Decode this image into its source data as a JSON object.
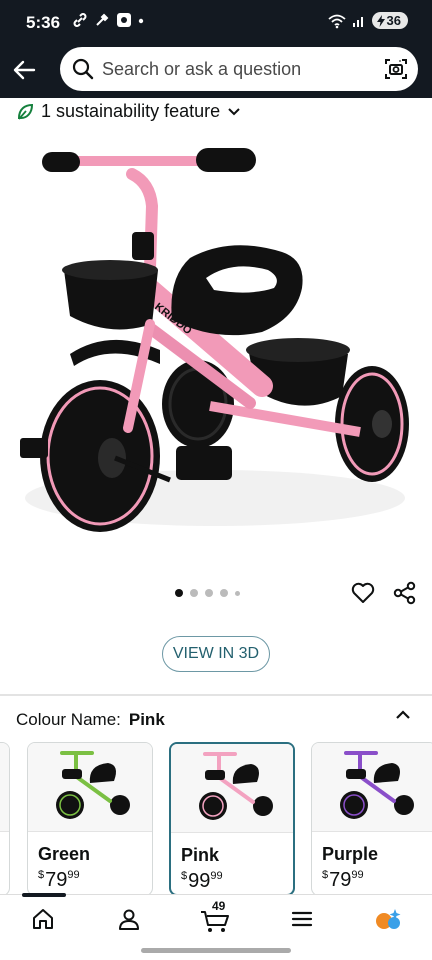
{
  "status_bar": {
    "time": "5:36",
    "battery_level": "36"
  },
  "search": {
    "placeholder": "Search or ask a question"
  },
  "sustainability": {
    "label": "1 sustainability feature"
  },
  "gallery": {
    "image_count": 5,
    "active_index": 0,
    "brand_mark": "KRIDDO"
  },
  "view_in_3d": {
    "label": "VIEW IN 3D"
  },
  "colour": {
    "label": "Colour Name:",
    "selected": "Pink"
  },
  "swatches": [
    {
      "name": "Green",
      "currency": "$",
      "dollars": "79",
      "cents": "99",
      "selected": false,
      "accent": "#7bc043"
    },
    {
      "name": "Pink",
      "currency": "$",
      "dollars": "99",
      "cents": "99",
      "selected": true,
      "accent": "#f3a2c0"
    },
    {
      "name": "Purple",
      "currency": "$",
      "dollars": "79",
      "cents": "99",
      "selected": false,
      "accent": "#8a4fc9"
    }
  ],
  "bottom_nav": {
    "cart_count": "49"
  },
  "colors": {
    "header_bg": "#131921",
    "accent_teal": "#2b6f80",
    "sustain_green": "#15803d",
    "product_pink": "#f29ab8"
  }
}
